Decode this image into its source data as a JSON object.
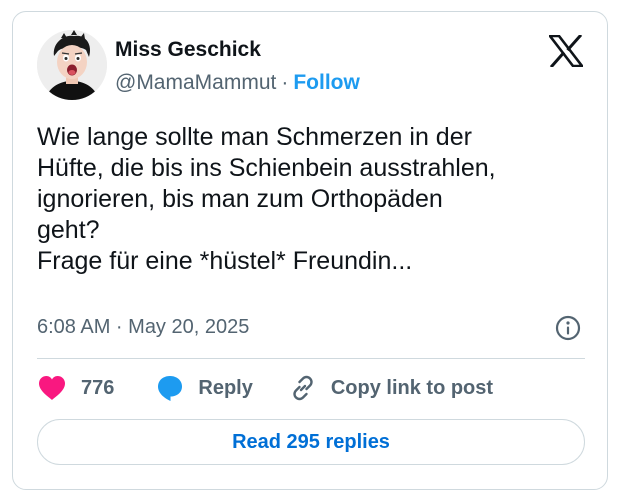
{
  "author": {
    "display_name": "Miss Geschick",
    "handle": "@MamaMammut",
    "separator": "·",
    "follow_label": "Follow"
  },
  "tweet": {
    "lines": [
      "Wie lange sollte man Schmerzen in der",
      "Hüfte, die bis ins Schienbein ausstrahlen,",
      "ignorieren, bis man zum Orthopäden",
      "geht?",
      "Frage für eine *hüstel* Freundin..."
    ],
    "timestamp": "6:08 AM · May 20, 2025"
  },
  "actions": {
    "like_count": "776",
    "reply_label": "Reply",
    "copy_link_label": "Copy link to post"
  },
  "read_replies_label": "Read 295 replies",
  "icons": {
    "logo": "x-logo-icon",
    "info": "info-icon",
    "like": "heart-icon",
    "reply": "speech-bubble-icon",
    "copy": "link-icon"
  },
  "colors": {
    "accent": "#1d9bf0",
    "replies_link": "#006fd6",
    "like": "#f91880",
    "muted": "#536471",
    "border": "#cfd9de"
  }
}
